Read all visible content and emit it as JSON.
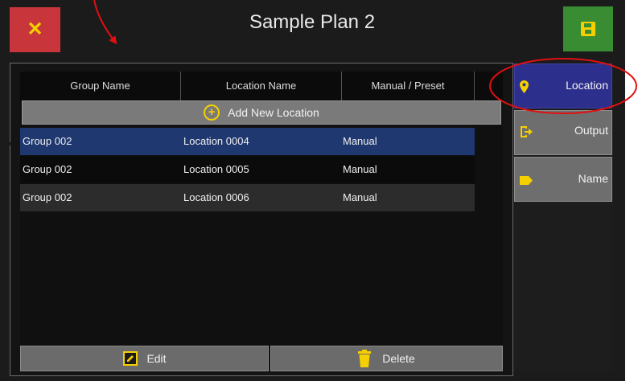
{
  "window": {
    "title": "Sample Plan 2",
    "close_icon": "close-icon",
    "save_icon": "save-icon"
  },
  "table": {
    "headers": [
      "Group Name",
      "Location Name",
      "Manual / Preset"
    ],
    "add_label": "Add New Location",
    "add_icon": "plus-circle-icon",
    "rows": [
      {
        "group": "Group 002",
        "location": "Location 0004",
        "mode": "Manual",
        "selected": true
      },
      {
        "group": "Group 002",
        "location": "Location 0005",
        "mode": "Manual",
        "selected": false
      },
      {
        "group": "Group 002",
        "location": "Location 0006",
        "mode": "Manual",
        "selected": false
      }
    ]
  },
  "actions": {
    "edit_label": "Edit",
    "edit_icon": "edit-icon",
    "delete_label": "Delete",
    "delete_icon": "trash-icon"
  },
  "sidebar": {
    "items": [
      {
        "label": "Location",
        "icon": "map-pin-icon",
        "active": true
      },
      {
        "label": "Output",
        "icon": "output-icon",
        "active": false
      },
      {
        "label": "Name",
        "icon": "tag-icon",
        "active": false
      }
    ]
  },
  "colors": {
    "accent_yellow": "#f5d000",
    "active_blue": "#2d2f8c",
    "selected_row": "#1f3870",
    "close_red": "#c8353a",
    "save_green": "#3a8c32",
    "annotation_red": "#e01010"
  }
}
